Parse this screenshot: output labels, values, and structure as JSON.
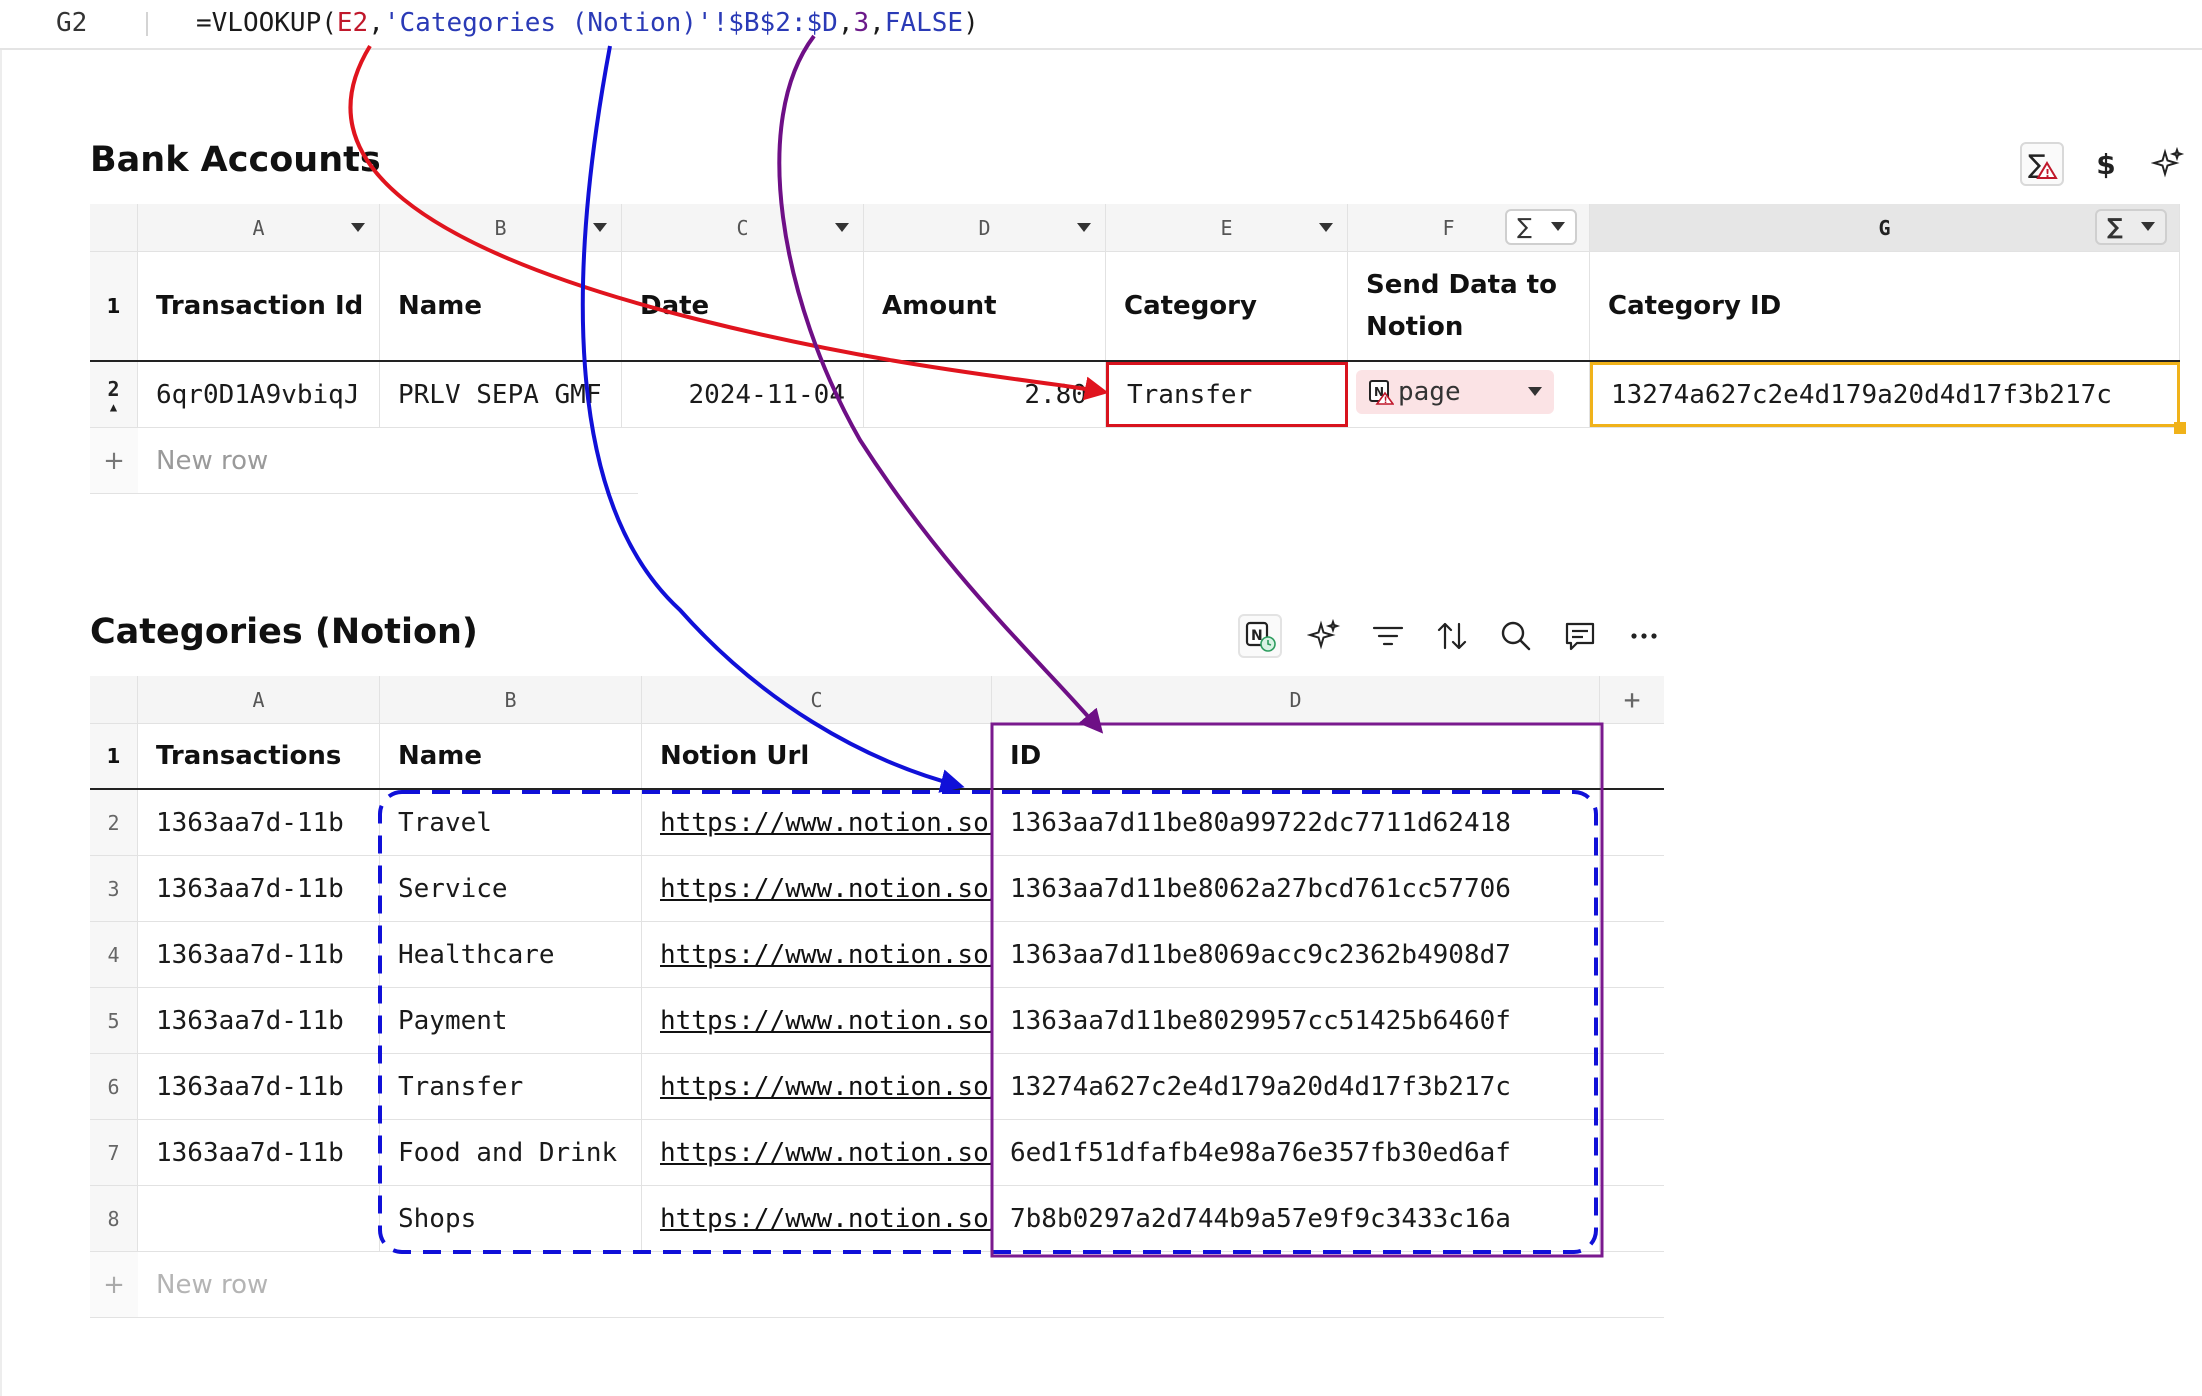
{
  "formula_bar": {
    "cell_ref": "G2",
    "formula_parts": [
      "=VLOOKUP(",
      "E2",
      ",",
      "'Categories (Notion)'!$B$2:$D",
      ",",
      "3",
      ",",
      "FALSE",
      ")"
    ]
  },
  "bank": {
    "title": "Bank Accounts",
    "columns": [
      {
        "letter": "A",
        "header": "Transaction Id"
      },
      {
        "letter": "B",
        "header": "Name"
      },
      {
        "letter": "C",
        "header": "Date"
      },
      {
        "letter": "D",
        "header": "Amount"
      },
      {
        "letter": "E",
        "header": "Category"
      },
      {
        "letter": "F",
        "header_line1": "Send Data to",
        "header_line2": "Notion"
      },
      {
        "letter": "G",
        "header": "Category ID"
      }
    ],
    "row": {
      "num": "2",
      "transaction_id": "6qr0D1A9vbiqJ",
      "name": "PRLV SEPA GMF",
      "date": "2024-11-04",
      "amount": "2.80",
      "category": "Transfer",
      "send_data": "page",
      "category_id": "13274a627c2e4d179a20d4d17f3b217c"
    },
    "header_row_num": "1",
    "new_row_label": "New row",
    "sigma": "∑",
    "dollar": "$"
  },
  "categories": {
    "title": "Categories (Notion)",
    "columns": [
      {
        "letter": "A",
        "header": "Transactions"
      },
      {
        "letter": "B",
        "header": "Name"
      },
      {
        "letter": "C",
        "header": "Notion Url"
      },
      {
        "letter": "D",
        "header": "ID"
      }
    ],
    "header_row_num": "1",
    "rows": [
      {
        "num": "2",
        "transactions": "1363aa7d-11b",
        "name": "Travel",
        "url": "https://www.notion.so/",
        "id": "1363aa7d11be80a99722dc7711d62418"
      },
      {
        "num": "3",
        "transactions": "1363aa7d-11b",
        "name": "Service",
        "url": "https://www.notion.so/",
        "id": "1363aa7d11be8062a27bcd761cc57706"
      },
      {
        "num": "4",
        "transactions": "1363aa7d-11b",
        "name": "Healthcare",
        "url": "https://www.notion.so/",
        "id": "1363aa7d11be8069acc9c2362b4908d7"
      },
      {
        "num": "5",
        "transactions": "1363aa7d-11b",
        "name": "Payment",
        "url": "https://www.notion.so/",
        "id": "1363aa7d11be8029957cc51425b6460f"
      },
      {
        "num": "6",
        "transactions": "1363aa7d-11b",
        "name": "Transfer",
        "url": "https://www.notion.so/",
        "id": "13274a627c2e4d179a20d4d17f3b217c"
      },
      {
        "num": "7",
        "transactions": "1363aa7d-11b",
        "name": "Food and Drink",
        "url": "https://www.notion.so/",
        "id": "6ed1f51dfafb4e98a76e357fb30ed6af"
      },
      {
        "num": "8",
        "transactions": "",
        "name": "Shops",
        "url": "https://www.notion.so/",
        "id": "7b8b0297a2d744b9a57e9f9c3433c16a"
      }
    ],
    "new_row_label": "New row",
    "plus": "+"
  },
  "colors": {
    "red_arrow": "#e0141e",
    "blue_arrow": "#1010d8",
    "purple_arrow": "#6e0f86",
    "selection": "#f0b21a"
  }
}
